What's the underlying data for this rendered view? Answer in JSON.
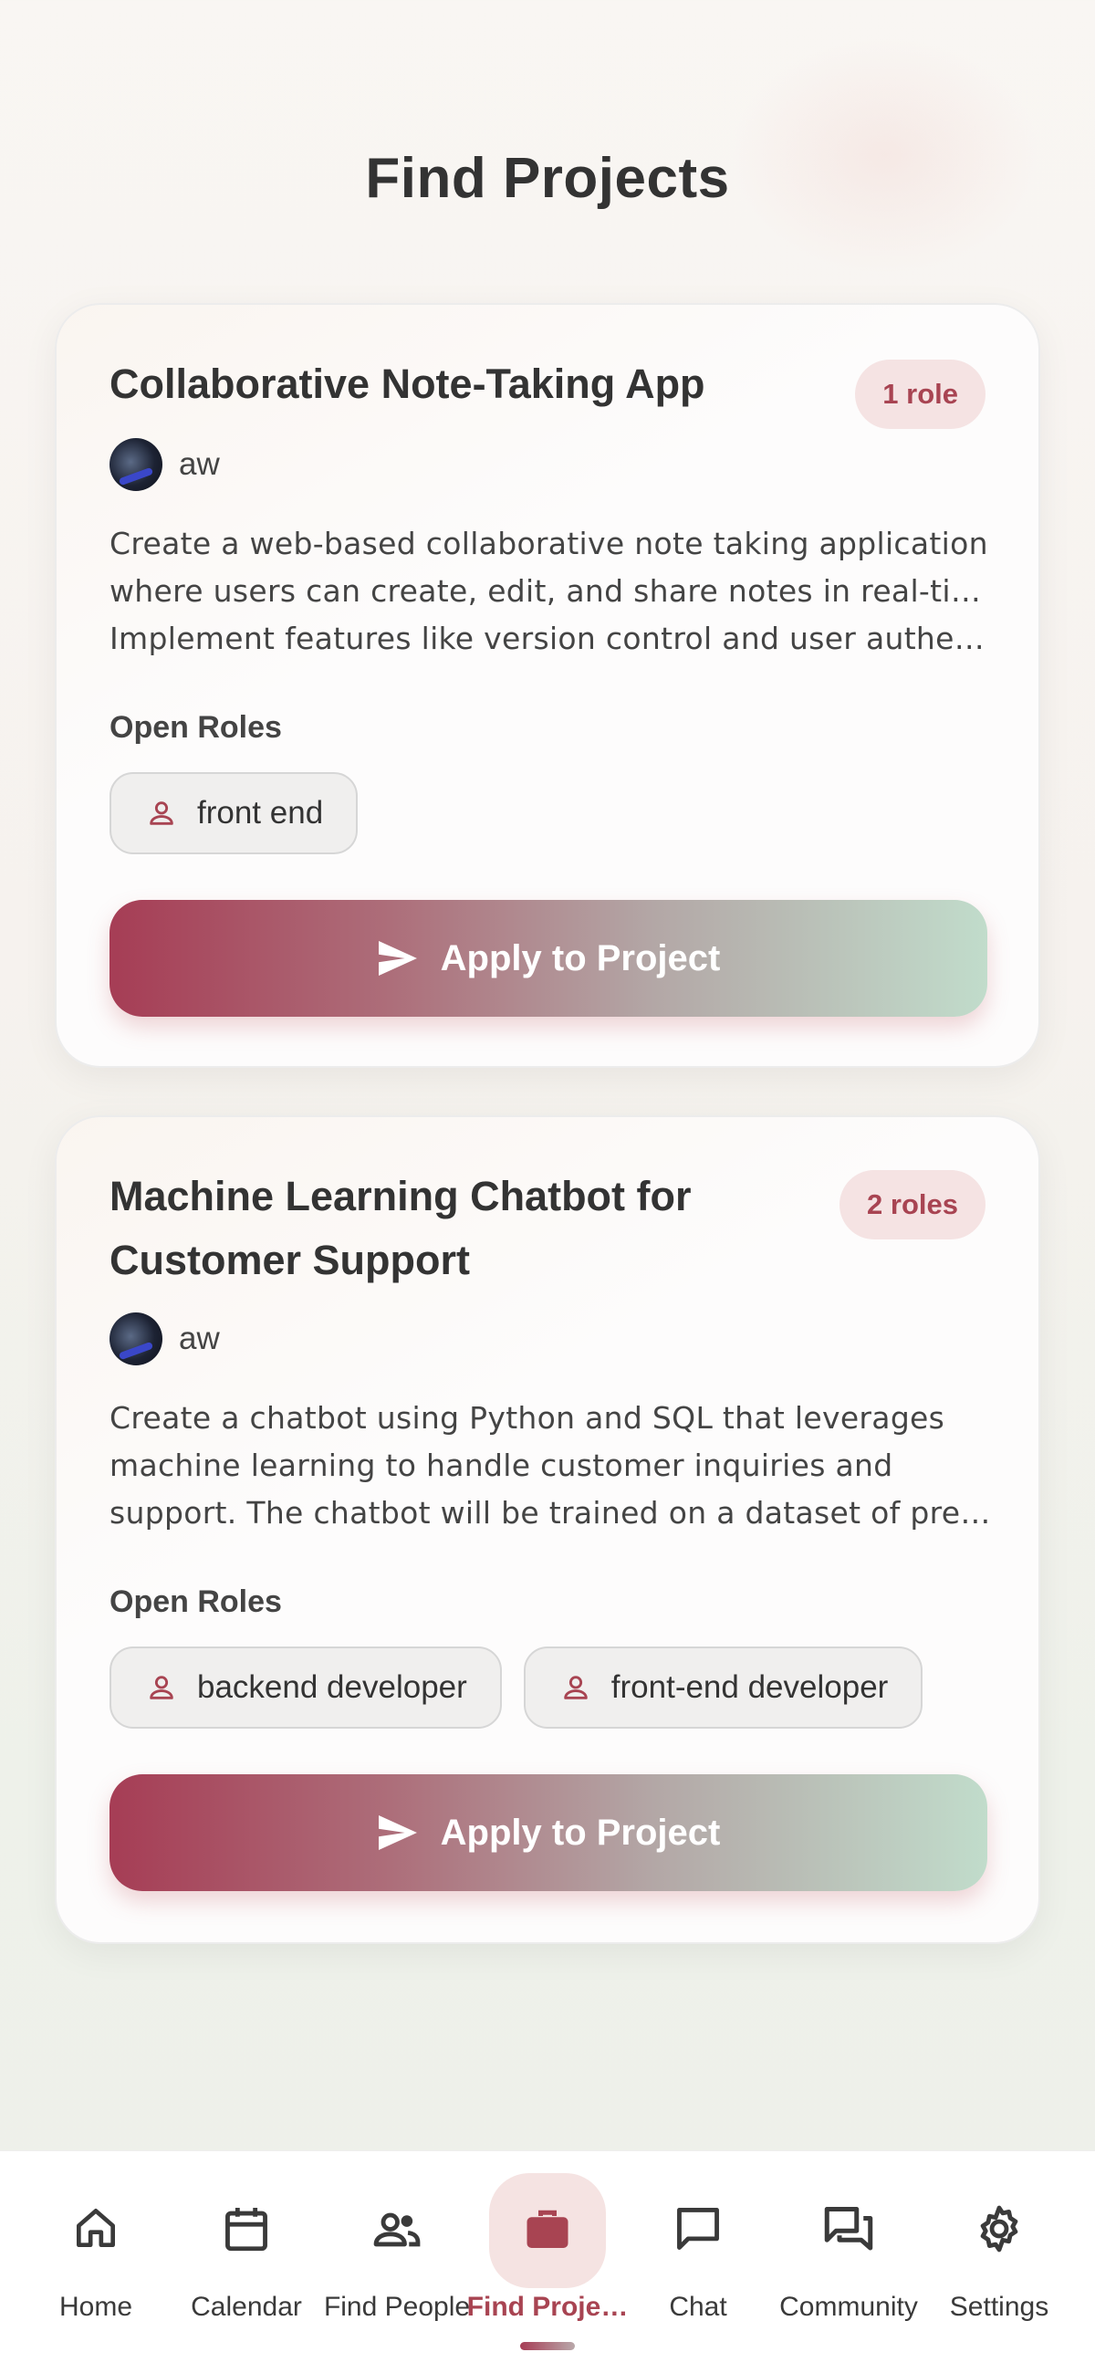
{
  "header": {
    "title": "Find Projects"
  },
  "projects": [
    {
      "title_lines": [
        "Collaborative Note-Taking App"
      ],
      "roles_badge": "1 role",
      "author": "aw",
      "description_lines": [
        "Create a web-based collaborative note taking application",
        "where users can create, edit, and share notes in real-time.",
        "Implement features like version control and user authen…"
      ],
      "open_roles_label": "Open Roles",
      "roles": [
        "front end"
      ],
      "apply_label": "Apply to Project"
    },
    {
      "title_lines": [
        "Machine Learning Chatbot for",
        "Customer Support"
      ],
      "roles_badge": "2 roles",
      "author": "aw",
      "description_lines": [
        "Create a chatbot using Python and SQL that leverages",
        "machine learning to handle customer inquiries and",
        "support. The chatbot will be trained on a dataset of prev…"
      ],
      "open_roles_label": "Open Roles",
      "roles": [
        "backend developer",
        "front-end developer"
      ],
      "apply_label": "Apply to Project"
    }
  ],
  "nav": {
    "items": [
      {
        "label": "Home",
        "icon": "home-icon"
      },
      {
        "label": "Calendar",
        "icon": "calendar-icon"
      },
      {
        "label": "Find People",
        "icon": "people-icon"
      },
      {
        "label": "Find Proje…",
        "icon": "briefcase-icon",
        "active": true
      },
      {
        "label": "Chat",
        "icon": "chat-icon"
      },
      {
        "label": "Community",
        "icon": "forum-icon"
      },
      {
        "label": "Settings",
        "icon": "gear-icon"
      }
    ]
  },
  "colors": {
    "accent": "#a84452",
    "badge_bg": "#f5e3e3",
    "button_gradient_start": "#a63d55",
    "button_gradient_end": "#c1dccb"
  }
}
